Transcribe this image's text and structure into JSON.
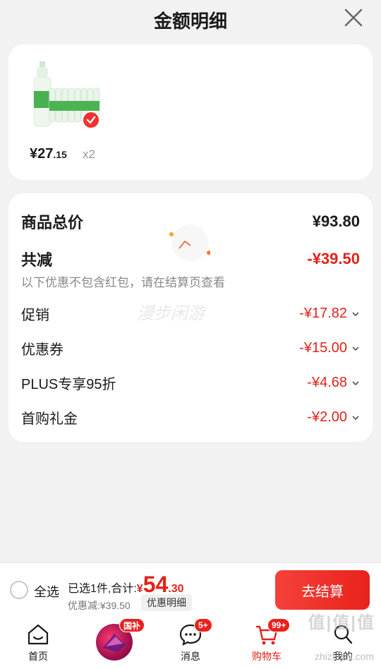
{
  "header": {
    "title": "金额明细"
  },
  "product": {
    "price_int": "¥27",
    "price_dec": ".15",
    "quantity": "x2"
  },
  "summary": {
    "total_label": "商品总价",
    "total_value": "¥93.80",
    "reduce_label": "共减",
    "reduce_value": "-¥39.50",
    "note": "以下优惠不包含红包，请在结算页查看",
    "watermark": "漫步闲游",
    "items": [
      {
        "label": "促销",
        "value": "-¥17.82"
      },
      {
        "label": "优惠券",
        "value": "-¥15.00"
      },
      {
        "label": "PLUS专享95折",
        "value": "-¥4.68"
      },
      {
        "label": "首购礼金",
        "value": "-¥2.00"
      }
    ]
  },
  "bottom": {
    "select_all": "全选",
    "selected_text": "已选1件,合计:",
    "currency": "¥",
    "total_int": "54",
    "total_dec": ".30",
    "discount": "优惠减:¥39.50",
    "detail_button": "优惠明细",
    "checkout_button": "去结算"
  },
  "tabs": [
    {
      "label": "首页",
      "icon": "home-icon"
    },
    {
      "label": "",
      "icon": "promo-icon",
      "badge": "国补"
    },
    {
      "label": "消息",
      "icon": "message-icon",
      "badge": "5+"
    },
    {
      "label": "购物车",
      "icon": "cart-icon",
      "badge": "99+",
      "active": true
    },
    {
      "label": "我的",
      "icon": "profile-icon"
    }
  ],
  "site_watermark": {
    "text": "值|值|值",
    "sub": "zhizhizhi.com"
  },
  "colors": {
    "accent": "#e2231a",
    "background": "#f2f2f2"
  }
}
